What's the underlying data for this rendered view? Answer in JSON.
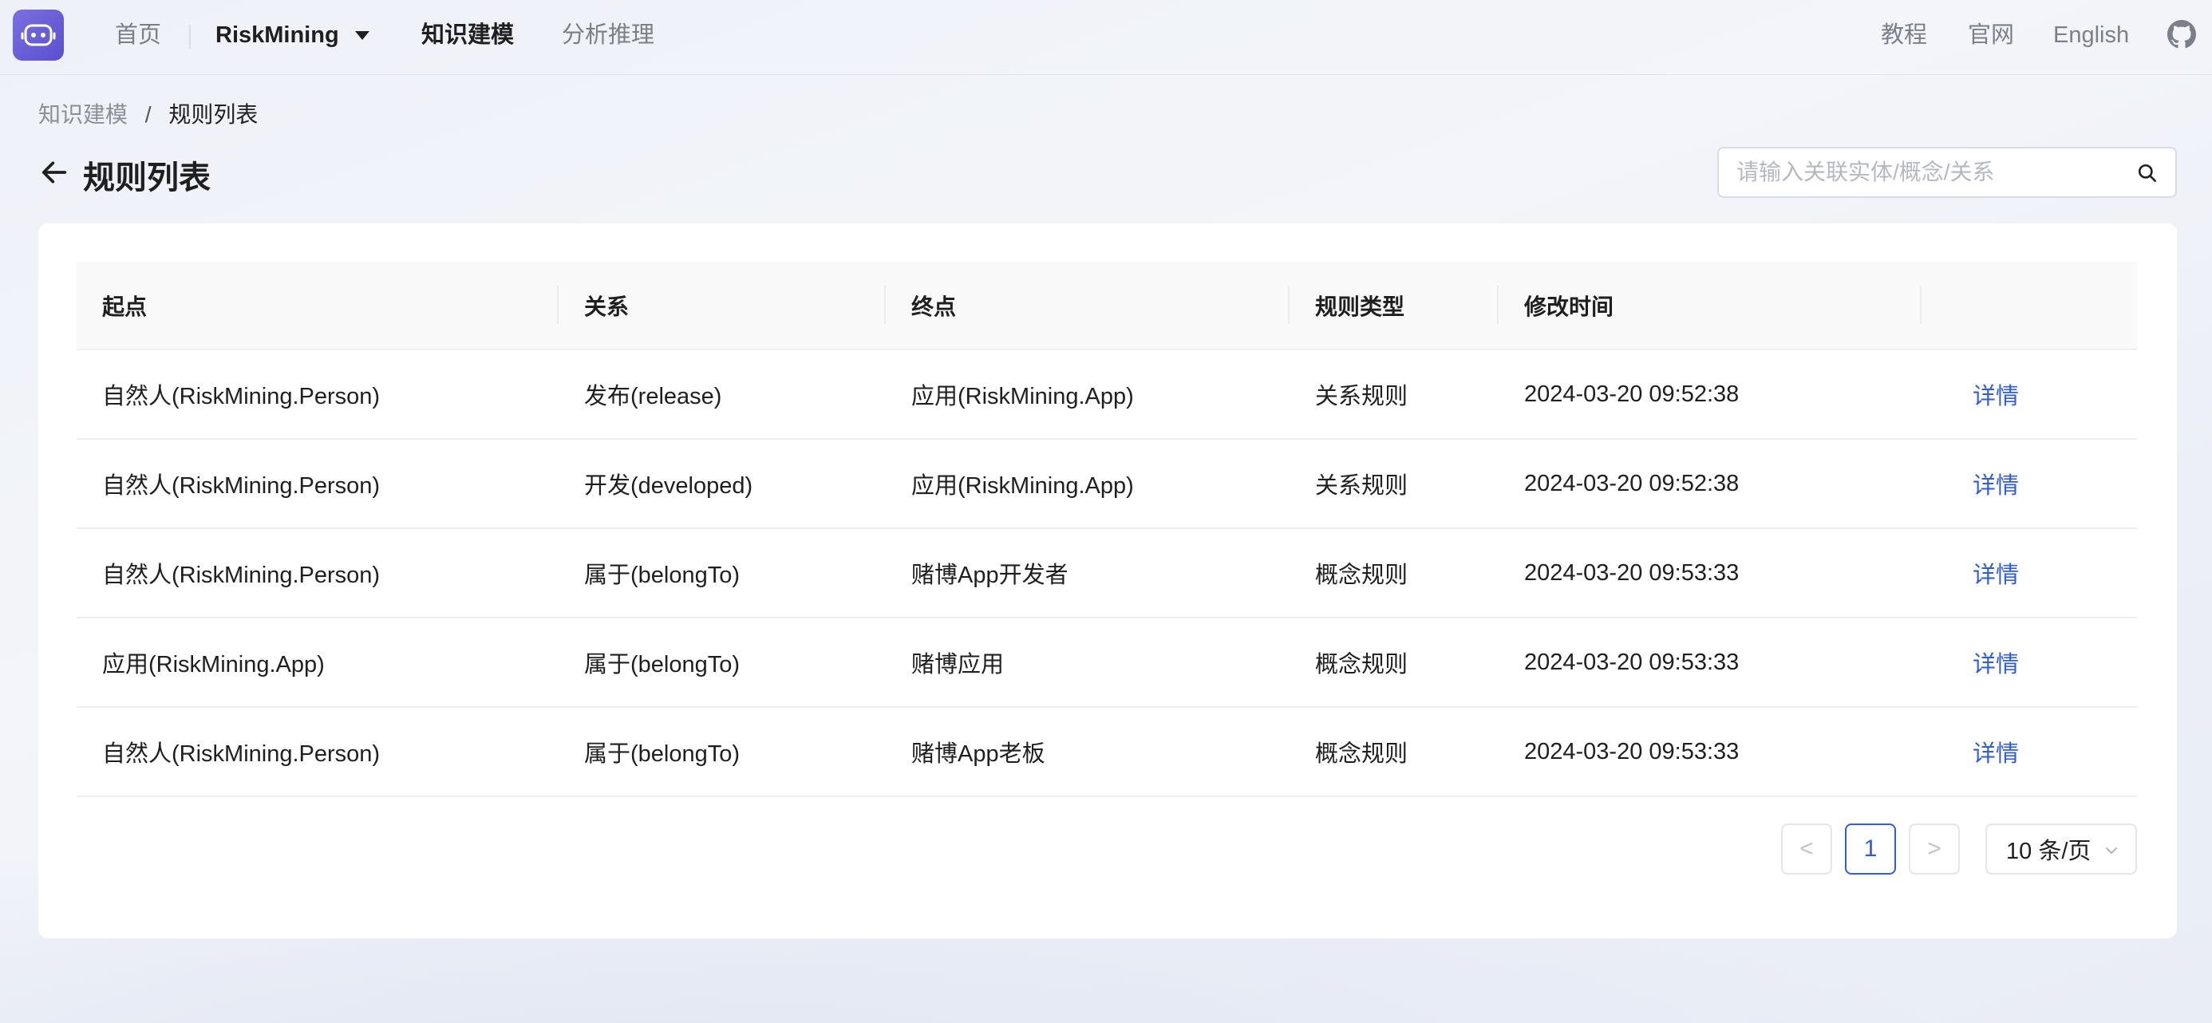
{
  "nav": {
    "home": "首页",
    "project": "RiskMining",
    "knowledge": "知识建模",
    "analysis": "分析推理",
    "tutorial": "教程",
    "official": "官网",
    "language": "English"
  },
  "breadcrumb": {
    "parent": "知识建模",
    "separator": "/",
    "current": "规则列表"
  },
  "page": {
    "title": "规则列表"
  },
  "search": {
    "placeholder": "请输入关联实体/概念/关系",
    "value": ""
  },
  "table": {
    "columns": [
      "起点",
      "关系",
      "终点",
      "规则类型",
      "修改时间",
      ""
    ],
    "rows": [
      {
        "start": "自然人(RiskMining.Person)",
        "relation": "发布(release)",
        "end": "应用(RiskMining.App)",
        "type": "关系规则",
        "time": "2024-03-20 09:52:38",
        "action": "详情"
      },
      {
        "start": "自然人(RiskMining.Person)",
        "relation": "开发(developed)",
        "end": "应用(RiskMining.App)",
        "type": "关系规则",
        "time": "2024-03-20 09:52:38",
        "action": "详情"
      },
      {
        "start": "自然人(RiskMining.Person)",
        "relation": "属于(belongTo)",
        "end": "赌博App开发者",
        "type": "概念规则",
        "time": "2024-03-20 09:53:33",
        "action": "详情"
      },
      {
        "start": "应用(RiskMining.App)",
        "relation": "属于(belongTo)",
        "end": "赌博应用",
        "type": "概念规则",
        "time": "2024-03-20 09:53:33",
        "action": "详情"
      },
      {
        "start": "自然人(RiskMining.Person)",
        "relation": "属于(belongTo)",
        "end": "赌博App老板",
        "type": "概念规则",
        "time": "2024-03-20 09:53:33",
        "action": "详情"
      }
    ]
  },
  "pagination": {
    "prev": "<",
    "current": "1",
    "next": ">",
    "page_size": "10 条/页"
  },
  "colors": {
    "accent": "#2e5cdc",
    "logo": "#6a5fd8"
  },
  "icons": {
    "logo": "robot-brain-logo",
    "github": "github-icon",
    "back": "arrow-left-icon",
    "search": "search-icon"
  }
}
